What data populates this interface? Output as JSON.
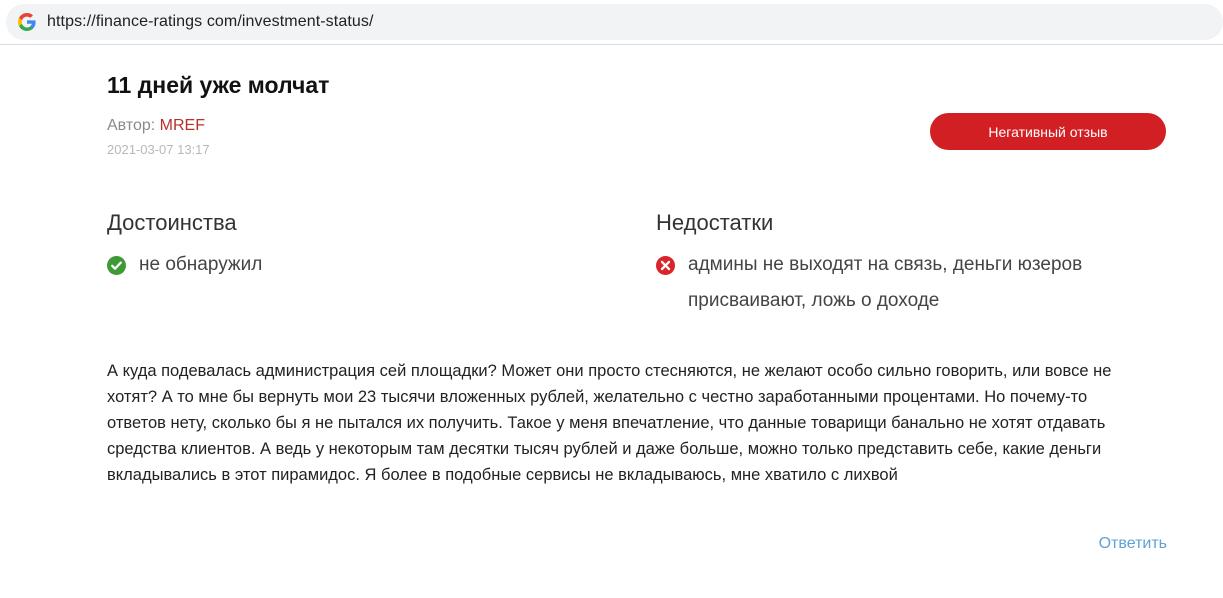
{
  "browser": {
    "url": "https://finance-ratings com/investment-status/",
    "favicon": "google-g-icon"
  },
  "review": {
    "title": "11 дней уже молчат",
    "author_label": "Автор: ",
    "author_name": "MREF",
    "date": "2021-03-07 13:17",
    "verdict_label": "Негативный отзыв",
    "verdict_color": "#d11f24",
    "pros_heading": "Достоинства",
    "pros_text": "не обнаружил",
    "pros_icon": "check-circle-icon",
    "cons_heading": "Недостатки",
    "cons_text": "админы не выходят на связь, деньги юзеров присваивают, ложь о доходе",
    "cons_icon": "x-circle-icon",
    "body": "А куда подевалась администрация сей площадки? Может они просто стесняются, не желают особо сильно говорить, или вовсе не хотят? А то мне бы вернуть мои 23 тысячи вложенных рублей, желательно с честно заработанными процентами. Но почему-то ответов нету, сколько бы я не пытался их получить. Такое у меня впечатление, что данные товарищи банально не хотят отдавать средства клиентов. А ведь у некоторым там десятки тысяч рублей и даже больше, можно только представить себе, какие деньги вкладывались в этот пирамидос. Я более в подобные сервисы не вкладываюсь, мне хватило с лихвой",
    "reply_label": "Ответить"
  },
  "colors": {
    "accent_red": "#d11f24",
    "author_red": "#b5312e",
    "pros_green": "#3f9a35",
    "cons_red": "#d9262b",
    "link_blue": "#5ea2d6"
  }
}
